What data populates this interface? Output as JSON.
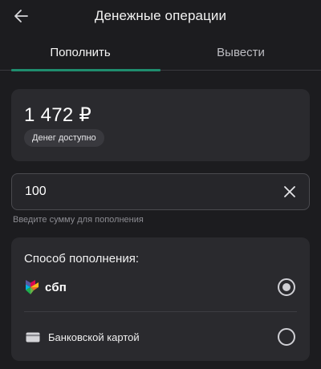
{
  "header": {
    "title": "Денежные операции",
    "back_icon": "arrow-left-icon"
  },
  "tabs": [
    {
      "label": "Пополнить",
      "active": true
    },
    {
      "label": "Вывести",
      "active": false
    }
  ],
  "balance": {
    "amount": "1 472 ₽",
    "badge": "Денег доступно"
  },
  "amount_input": {
    "value": "100",
    "hint": "Введите сумму для пополнения",
    "clear_icon": "close-icon"
  },
  "payment_method": {
    "title": "Способ пополнения:",
    "options": [
      {
        "label": "сбп",
        "icon": "sbp-logo-icon",
        "selected": true
      },
      {
        "label": "Банковской картой",
        "icon": "bank-card-icon",
        "selected": false
      }
    ]
  },
  "colors": {
    "background": "#1c1c1f",
    "card": "#2a2a2e",
    "accent": "#1f8d6e"
  }
}
